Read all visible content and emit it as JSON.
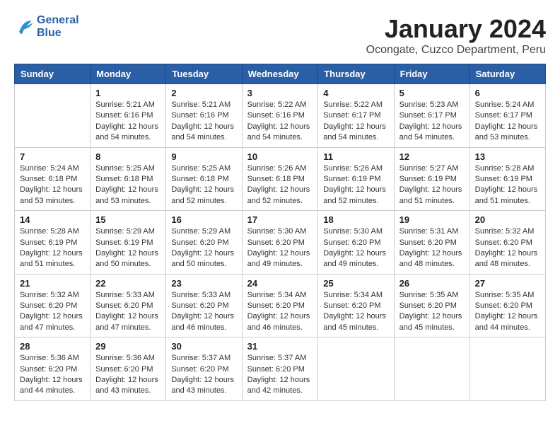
{
  "header": {
    "logo_line1": "General",
    "logo_line2": "Blue",
    "title": "January 2024",
    "subtitle": "Ocongate, Cuzco Department, Peru"
  },
  "days_of_week": [
    "Sunday",
    "Monday",
    "Tuesday",
    "Wednesday",
    "Thursday",
    "Friday",
    "Saturday"
  ],
  "weeks": [
    [
      {
        "day": "",
        "sunrise": "",
        "sunset": "",
        "daylight": ""
      },
      {
        "day": "1",
        "sunrise": "Sunrise: 5:21 AM",
        "sunset": "Sunset: 6:16 PM",
        "daylight": "Daylight: 12 hours and 54 minutes."
      },
      {
        "day": "2",
        "sunrise": "Sunrise: 5:21 AM",
        "sunset": "Sunset: 6:16 PM",
        "daylight": "Daylight: 12 hours and 54 minutes."
      },
      {
        "day": "3",
        "sunrise": "Sunrise: 5:22 AM",
        "sunset": "Sunset: 6:16 PM",
        "daylight": "Daylight: 12 hours and 54 minutes."
      },
      {
        "day": "4",
        "sunrise": "Sunrise: 5:22 AM",
        "sunset": "Sunset: 6:17 PM",
        "daylight": "Daylight: 12 hours and 54 minutes."
      },
      {
        "day": "5",
        "sunrise": "Sunrise: 5:23 AM",
        "sunset": "Sunset: 6:17 PM",
        "daylight": "Daylight: 12 hours and 54 minutes."
      },
      {
        "day": "6",
        "sunrise": "Sunrise: 5:24 AM",
        "sunset": "Sunset: 6:17 PM",
        "daylight": "Daylight: 12 hours and 53 minutes."
      }
    ],
    [
      {
        "day": "7",
        "sunrise": "Sunrise: 5:24 AM",
        "sunset": "Sunset: 6:18 PM",
        "daylight": "Daylight: 12 hours and 53 minutes."
      },
      {
        "day": "8",
        "sunrise": "Sunrise: 5:25 AM",
        "sunset": "Sunset: 6:18 PM",
        "daylight": "Daylight: 12 hours and 53 minutes."
      },
      {
        "day": "9",
        "sunrise": "Sunrise: 5:25 AM",
        "sunset": "Sunset: 6:18 PM",
        "daylight": "Daylight: 12 hours and 52 minutes."
      },
      {
        "day": "10",
        "sunrise": "Sunrise: 5:26 AM",
        "sunset": "Sunset: 6:18 PM",
        "daylight": "Daylight: 12 hours and 52 minutes."
      },
      {
        "day": "11",
        "sunrise": "Sunrise: 5:26 AM",
        "sunset": "Sunset: 6:19 PM",
        "daylight": "Daylight: 12 hours and 52 minutes."
      },
      {
        "day": "12",
        "sunrise": "Sunrise: 5:27 AM",
        "sunset": "Sunset: 6:19 PM",
        "daylight": "Daylight: 12 hours and 51 minutes."
      },
      {
        "day": "13",
        "sunrise": "Sunrise: 5:28 AM",
        "sunset": "Sunset: 6:19 PM",
        "daylight": "Daylight: 12 hours and 51 minutes."
      }
    ],
    [
      {
        "day": "14",
        "sunrise": "Sunrise: 5:28 AM",
        "sunset": "Sunset: 6:19 PM",
        "daylight": "Daylight: 12 hours and 51 minutes."
      },
      {
        "day": "15",
        "sunrise": "Sunrise: 5:29 AM",
        "sunset": "Sunset: 6:19 PM",
        "daylight": "Daylight: 12 hours and 50 minutes."
      },
      {
        "day": "16",
        "sunrise": "Sunrise: 5:29 AM",
        "sunset": "Sunset: 6:20 PM",
        "daylight": "Daylight: 12 hours and 50 minutes."
      },
      {
        "day": "17",
        "sunrise": "Sunrise: 5:30 AM",
        "sunset": "Sunset: 6:20 PM",
        "daylight": "Daylight: 12 hours and 49 minutes."
      },
      {
        "day": "18",
        "sunrise": "Sunrise: 5:30 AM",
        "sunset": "Sunset: 6:20 PM",
        "daylight": "Daylight: 12 hours and 49 minutes."
      },
      {
        "day": "19",
        "sunrise": "Sunrise: 5:31 AM",
        "sunset": "Sunset: 6:20 PM",
        "daylight": "Daylight: 12 hours and 48 minutes."
      },
      {
        "day": "20",
        "sunrise": "Sunrise: 5:32 AM",
        "sunset": "Sunset: 6:20 PM",
        "daylight": "Daylight: 12 hours and 48 minutes."
      }
    ],
    [
      {
        "day": "21",
        "sunrise": "Sunrise: 5:32 AM",
        "sunset": "Sunset: 6:20 PM",
        "daylight": "Daylight: 12 hours and 47 minutes."
      },
      {
        "day": "22",
        "sunrise": "Sunrise: 5:33 AM",
        "sunset": "Sunset: 6:20 PM",
        "daylight": "Daylight: 12 hours and 47 minutes."
      },
      {
        "day": "23",
        "sunrise": "Sunrise: 5:33 AM",
        "sunset": "Sunset: 6:20 PM",
        "daylight": "Daylight: 12 hours and 46 minutes."
      },
      {
        "day": "24",
        "sunrise": "Sunrise: 5:34 AM",
        "sunset": "Sunset: 6:20 PM",
        "daylight": "Daylight: 12 hours and 46 minutes."
      },
      {
        "day": "25",
        "sunrise": "Sunrise: 5:34 AM",
        "sunset": "Sunset: 6:20 PM",
        "daylight": "Daylight: 12 hours and 45 minutes."
      },
      {
        "day": "26",
        "sunrise": "Sunrise: 5:35 AM",
        "sunset": "Sunset: 6:20 PM",
        "daylight": "Daylight: 12 hours and 45 minutes."
      },
      {
        "day": "27",
        "sunrise": "Sunrise: 5:35 AM",
        "sunset": "Sunset: 6:20 PM",
        "daylight": "Daylight: 12 hours and 44 minutes."
      }
    ],
    [
      {
        "day": "28",
        "sunrise": "Sunrise: 5:36 AM",
        "sunset": "Sunset: 6:20 PM",
        "daylight": "Daylight: 12 hours and 44 minutes."
      },
      {
        "day": "29",
        "sunrise": "Sunrise: 5:36 AM",
        "sunset": "Sunset: 6:20 PM",
        "daylight": "Daylight: 12 hours and 43 minutes."
      },
      {
        "day": "30",
        "sunrise": "Sunrise: 5:37 AM",
        "sunset": "Sunset: 6:20 PM",
        "daylight": "Daylight: 12 hours and 43 minutes."
      },
      {
        "day": "31",
        "sunrise": "Sunrise: 5:37 AM",
        "sunset": "Sunset: 6:20 PM",
        "daylight": "Daylight: 12 hours and 42 minutes."
      },
      {
        "day": "",
        "sunrise": "",
        "sunset": "",
        "daylight": ""
      },
      {
        "day": "",
        "sunrise": "",
        "sunset": "",
        "daylight": ""
      },
      {
        "day": "",
        "sunrise": "",
        "sunset": "",
        "daylight": ""
      }
    ]
  ]
}
